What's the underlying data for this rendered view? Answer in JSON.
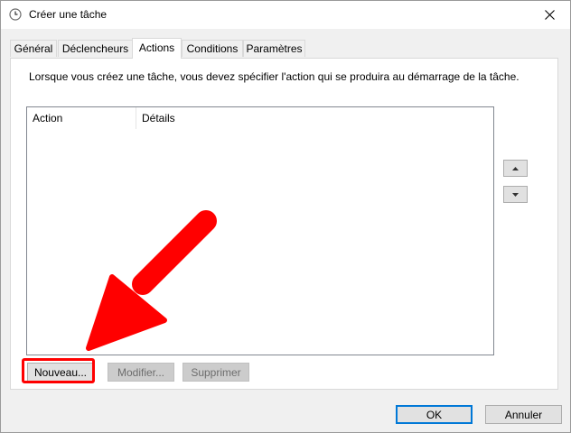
{
  "window": {
    "title": "Créer une tâche",
    "icons": {
      "app": "clock-icon",
      "close": "close-icon"
    }
  },
  "tabs": [
    {
      "label": "Général"
    },
    {
      "label": "Déclencheurs"
    },
    {
      "label": "Actions",
      "active": true
    },
    {
      "label": "Conditions"
    },
    {
      "label": "Paramètres"
    }
  ],
  "actions": {
    "description": "Lorsque vous créez une tâche, vous devez spécifier l'action qui se produira au démarrage de la tâche.",
    "columns": {
      "action": "Action",
      "details": "Détails"
    },
    "move_up_icon": "triangle-up-icon",
    "move_down_icon": "triangle-down-icon",
    "buttons": {
      "new": "Nouveau...",
      "edit": "Modifier...",
      "delete": "Supprimer"
    }
  },
  "footer": {
    "ok": "OK",
    "cancel": "Annuler"
  },
  "colors": {
    "highlight": "#ff0000",
    "accent": "#0078d7"
  }
}
